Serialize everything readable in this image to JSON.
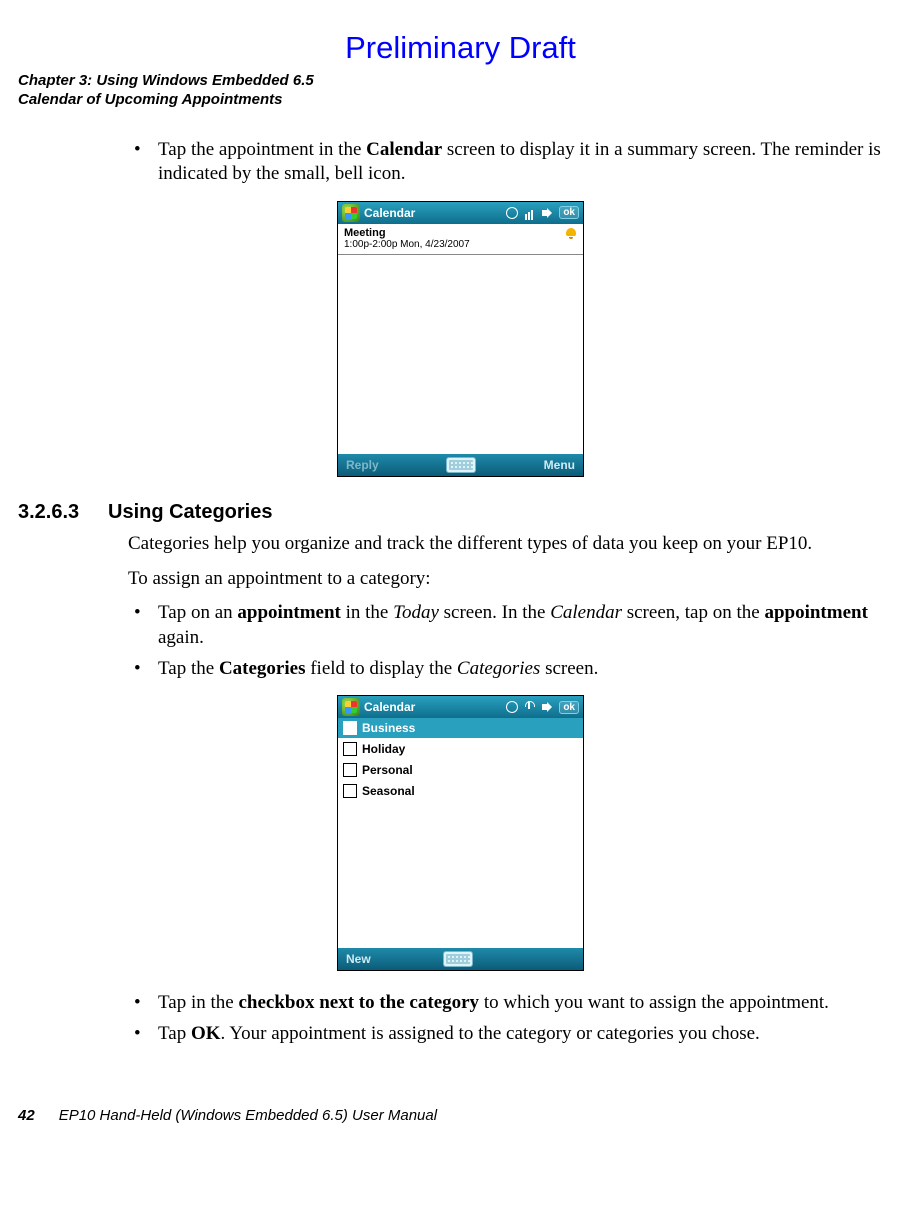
{
  "draft_banner": "Preliminary Draft",
  "header": {
    "chapter_line": "Chapter 3:  Using Windows Embedded 6.5",
    "section_line": "Calendar of Upcoming Appointments"
  },
  "intro_bullet": {
    "pre": "Tap the appointment in the ",
    "b1": "Calendar",
    "post": " screen to display it in a summary screen. The reminder is indicated by the small, bell icon."
  },
  "fig1": {
    "title": "Calendar",
    "ok": "ok",
    "meeting_label": "Meeting",
    "meeting_time": "1:00p-2:00p Mon, 4/23/2007",
    "left_soft": "Reply",
    "right_soft": "Menu"
  },
  "section": {
    "num": "3.2.6.3",
    "title": "Using Categories"
  },
  "para1": "Categories help you organize and track the different types of data you keep on your EP10.",
  "para2": "To assign an appointment to a category:",
  "bullets2": {
    "b1_pre": "Tap on an ",
    "b1_bold1": "appointment",
    "b1_mid1": " in the ",
    "b1_it1": "Today",
    "b1_mid2": " screen. In the ",
    "b1_it2": "Calendar",
    "b1_mid3": " screen, tap on the ",
    "b1_bold2": "appointment",
    "b1_post": " again.",
    "b2_pre": "Tap the ",
    "b2_bold": "Categories",
    "b2_mid": " field to display the ",
    "b2_it": "Categories",
    "b2_post": " screen."
  },
  "fig2": {
    "title": "Calendar",
    "ok": "ok",
    "cats": [
      "Business",
      "Holiday",
      "Personal",
      "Seasonal"
    ],
    "left_soft": "New"
  },
  "bullets3": {
    "b1_pre": "Tap in the ",
    "b1_bold": "checkbox next to the category",
    "b1_post": " to which you want to assign the appointment.",
    "b2_pre": "Tap ",
    "b2_bold": "OK",
    "b2_post": ". Your appointment is assigned to the category or categories you chose."
  },
  "footer": {
    "page": "42",
    "manual": "EP10 Hand-Held (Windows Embedded 6.5) User Manual"
  }
}
